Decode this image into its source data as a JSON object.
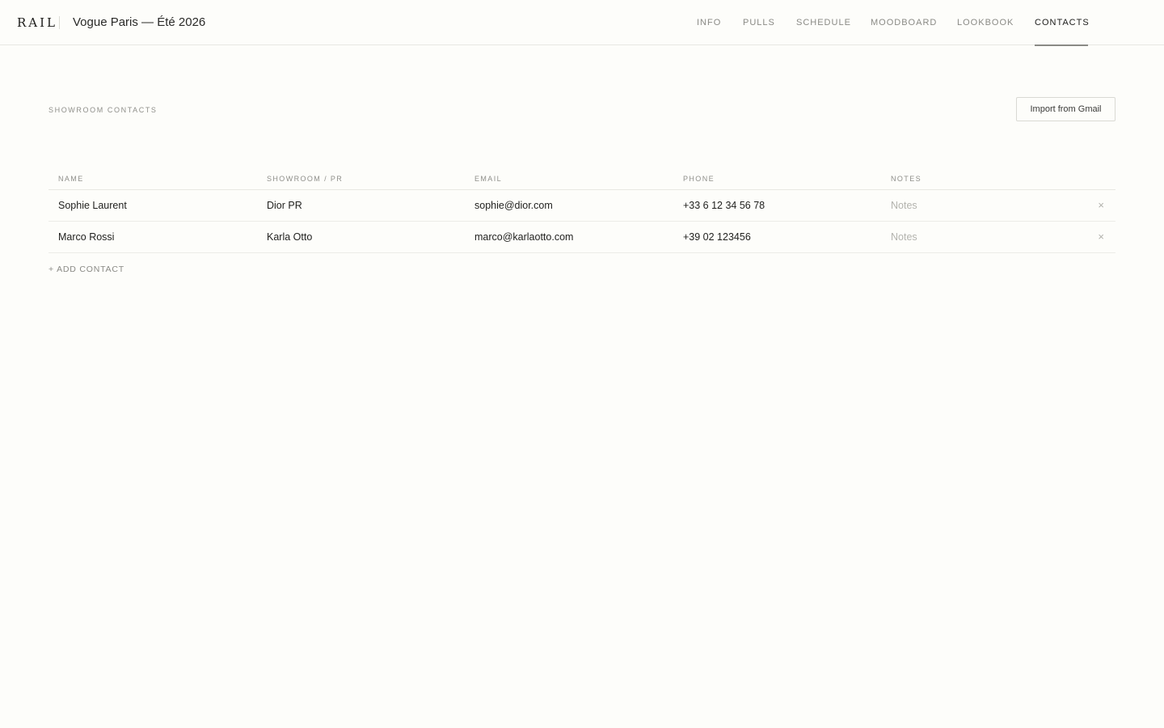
{
  "header": {
    "logo": "RAIL",
    "project_title": "Vogue Paris — Été 2026",
    "tabs": [
      {
        "label": "INFO",
        "active": false
      },
      {
        "label": "PULLS",
        "active": false
      },
      {
        "label": "SCHEDULE",
        "active": false
      },
      {
        "label": "MOODBOARD",
        "active": false
      },
      {
        "label": "LOOKBOOK",
        "active": false
      },
      {
        "label": "CONTACTS",
        "active": true
      }
    ]
  },
  "section": {
    "title": "SHOWROOM CONTACTS",
    "import_label": "Import from Gmail"
  },
  "table": {
    "columns": [
      "NAME",
      "SHOWROOM / PR",
      "EMAIL",
      "PHONE",
      "NOTES"
    ],
    "rows": [
      {
        "name": "Sophie Laurent",
        "showroom": "Dior PR",
        "email": "sophie@dior.com",
        "phone": "+33 6 12 34 56 78",
        "notes_placeholder": "Notes",
        "remove": "×"
      },
      {
        "name": "Marco Rossi",
        "showroom": "Karla Otto",
        "email": "marco@karlaotto.com",
        "phone": "+39 02 123456",
        "notes_placeholder": "Notes",
        "remove": "×"
      }
    ]
  },
  "add_contact_label": "+ ADD CONTACT",
  "colors": {
    "background": "#fdfdfa",
    "text": "#1c1c1a",
    "muted": "#8a8a85",
    "border": "#e8e8e3"
  }
}
